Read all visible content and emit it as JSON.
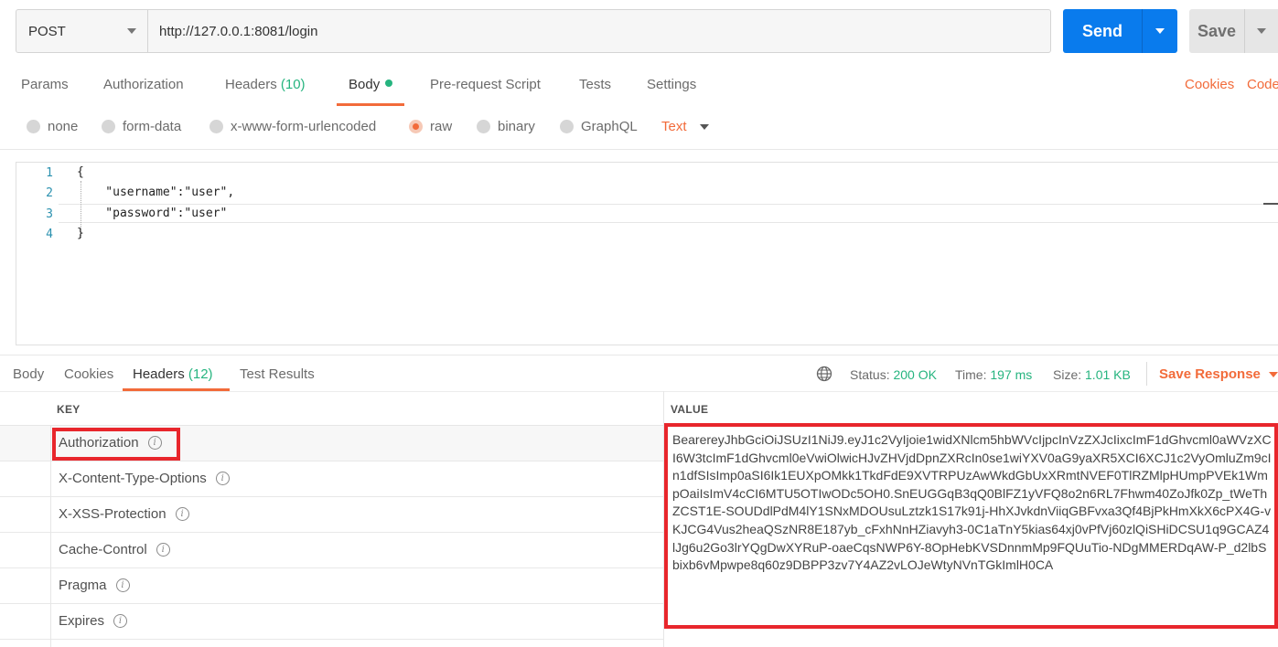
{
  "request": {
    "method": "POST",
    "url": "http://127.0.0.1:8081/login",
    "send_label": "Send",
    "save_label": "Save"
  },
  "request_tabs": [
    {
      "label": "Params"
    },
    {
      "label": "Authorization"
    },
    {
      "label": "Headers",
      "count": "(10)"
    },
    {
      "label": "Body",
      "active": true
    },
    {
      "label": "Pre-request Script"
    },
    {
      "label": "Tests"
    },
    {
      "label": "Settings"
    }
  ],
  "links": {
    "cookies": "Cookies",
    "code": "Code"
  },
  "body_types": [
    {
      "label": "none"
    },
    {
      "label": "form-data"
    },
    {
      "label": "x-www-form-urlencoded"
    },
    {
      "label": "raw",
      "selected": true
    },
    {
      "label": "binary"
    },
    {
      "label": "GraphQL"
    }
  ],
  "raw_format": "Text",
  "editor": {
    "lines": [
      {
        "num": "1",
        "code": "{"
      },
      {
        "num": "2",
        "code": "    \"username\":\"user\","
      },
      {
        "num": "3",
        "code": "    \"password\":\"user\""
      },
      {
        "num": "4",
        "code": "}"
      }
    ]
  },
  "response_tabs": [
    {
      "label": "Body"
    },
    {
      "label": "Cookies"
    },
    {
      "label": "Headers",
      "count": "(12)",
      "active": true
    },
    {
      "label": "Test Results"
    }
  ],
  "status": {
    "status_label": "Status:",
    "status_value": "200 OK",
    "time_label": "Time:",
    "time_value": "197 ms",
    "size_label": "Size:",
    "size_value": "1.01 KB"
  },
  "save_response_label": "Save Response",
  "headers_table": {
    "key_header": "KEY",
    "value_header": "VALUE",
    "rows": [
      {
        "key": "Authorization"
      },
      {
        "key": "X-Content-Type-Options"
      },
      {
        "key": "X-XSS-Protection"
      },
      {
        "key": "Cache-Control"
      },
      {
        "key": "Pragma"
      },
      {
        "key": "Expires"
      }
    ],
    "authorization_value": "BearereyJhbGciOiJSUzI1NiJ9.eyJ1c2VyIjoie1widXNlcm5hbWVcIjpcInVzZXJcIixcImF1dGhvcml0aWVzXCI6W3tcImF1dGhvcml0eVwiOlwicHJvZHVjdDpnZXRcIn0se1wiYXV0aG9yaXR5XCI6XCJ1c2VyOmluZm9cIn1dfSIsImp0aSI6Ik1EUXpOMkk1TkdFdE9XVTRPUzAwWkdGbUxXRmtNVEF0TlRZMlpHUmpPVEk1WmpOaiIsImV4cCI6MTU5OTIwODc5OH0.SnEUGGqB3qQ0BlFZ1yVFQ8o2n6RL7Fhwm40ZoJfk0Zp_tWeThZCST1E-SOUDdlPdM4lY1SNxMDOUsuLztzk1S17k91j-HhXJvkdnViiqGBFvxa3Qf4BjPkHmXkX6cPX4G-vKJCG4Vus2heaQSzNR8E187yb_cFxhNnHZiavyh3-0C1aTnY5kias64xj0vPfVj60zlQiSHiDCSU1q9GCAZ4lJg6u2Go3lrYQgDwXYRuP-oaeCqsNWP6Y-8OpHebKVSDnnmMp9FQUuTio-NDgMMERDqAW-P_d2lbSbixb6vMpwpe8q60z9DBPP3zv7Y4AZ2vLOJeWtyNVnTGkImlH0CA"
  },
  "colors": {
    "accent": "#f26b3a",
    "send_blue": "#097bed",
    "success_green": "#26b47f",
    "highlight_red": "#e8262c"
  }
}
